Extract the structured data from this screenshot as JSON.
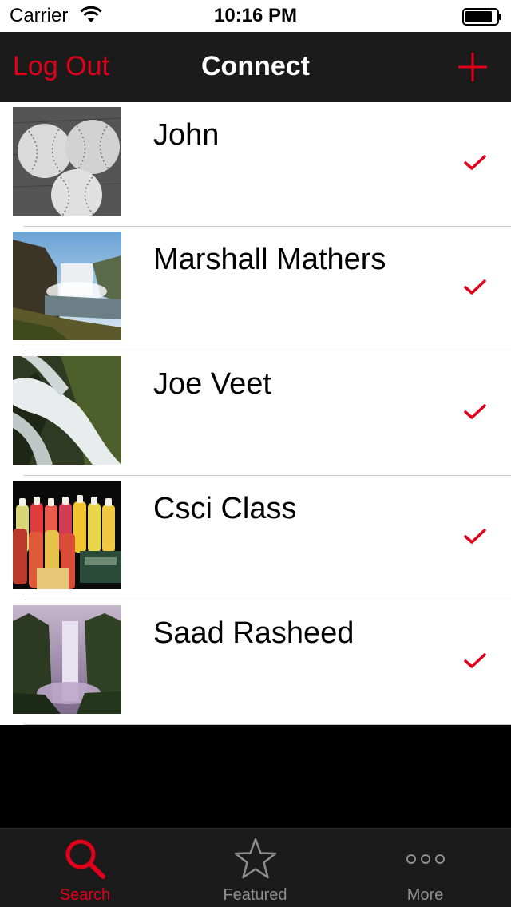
{
  "status": {
    "carrier": "Carrier",
    "time": "10:16 PM"
  },
  "nav": {
    "left_label": "Log Out",
    "title": "Connect",
    "add_icon": "plus-icon"
  },
  "contacts": [
    {
      "name": "John",
      "thumb": "baseballs",
      "checked": true
    },
    {
      "name": "Marshall Mathers",
      "thumb": "waterfall-valley",
      "checked": true
    },
    {
      "name": "Joe Veet",
      "thumb": "waterfall-closeup",
      "checked": true
    },
    {
      "name": "Csci Class",
      "thumb": "juice-bottles",
      "checked": true
    },
    {
      "name": "Saad Rasheed",
      "thumb": "waterfall-canyon",
      "checked": true
    }
  ],
  "tabs": [
    {
      "label": "Search",
      "icon": "search-icon",
      "active": true
    },
    {
      "label": "Featured",
      "icon": "star-icon",
      "active": false
    },
    {
      "label": "More",
      "icon": "more-icon",
      "active": false
    }
  ],
  "colors": {
    "accent": "#e0001b",
    "nav_background": "#1b1b1b",
    "tab_inactive": "#8e8e8e"
  }
}
